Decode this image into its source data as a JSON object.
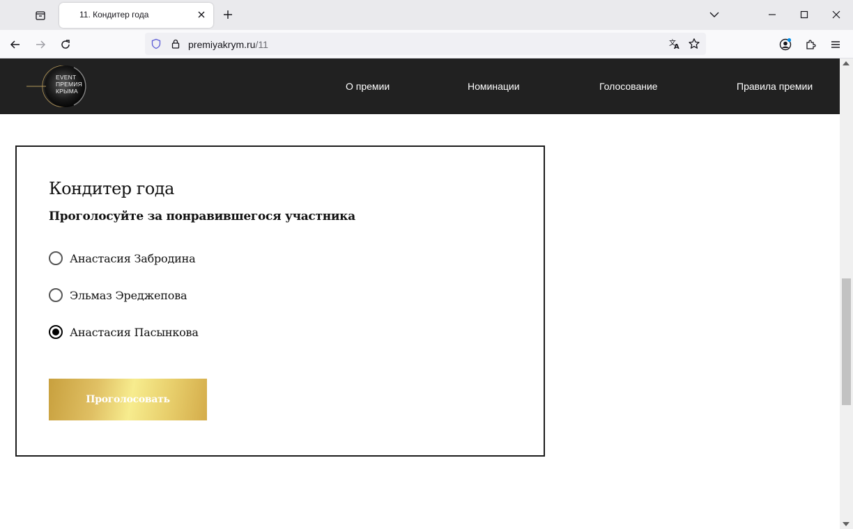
{
  "browser": {
    "tab_title": "11. Кондитер года",
    "url_host": "premiyakrym.ru",
    "url_path": "/11"
  },
  "site": {
    "logo_lines": [
      "EVENT",
      "ПРЕМИЯ",
      "КРЫМА"
    ],
    "menu": [
      {
        "label": "О премии"
      },
      {
        "label": "Номинации"
      },
      {
        "label": "Голосование"
      },
      {
        "label": "Правила премии"
      }
    ]
  },
  "poll": {
    "title": "Кондитер года",
    "subtitle": "Проголосуйте за понравившегося участника",
    "options": [
      {
        "label": "Анастасия Забродина",
        "selected": false
      },
      {
        "label": "Эльмаз Эреджепова",
        "selected": false
      },
      {
        "label": "Анастасия Пасынкова",
        "selected": true
      }
    ],
    "submit_label": "Проголосовать"
  },
  "colors": {
    "header_bg": "#212121",
    "button_gold": "#e8cf6c"
  },
  "icons": {
    "tab_overview": "tab-overview-icon",
    "close": "close-icon",
    "new_tab": "plus-icon",
    "back": "back-arrow-icon",
    "forward": "forward-arrow-icon",
    "reload": "reload-icon",
    "shield": "shield-icon",
    "lock": "lock-icon",
    "translate": "translate-icon",
    "bookmark": "star-icon",
    "account": "account-icon",
    "extensions": "puzzle-icon",
    "menu": "hamburger-icon"
  }
}
